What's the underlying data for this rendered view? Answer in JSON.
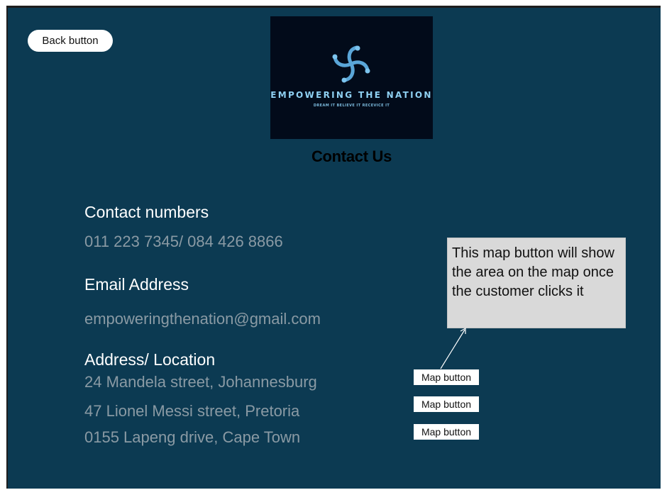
{
  "header": {
    "back_button_label": "Back button",
    "logo": {
      "title": "EMPOWERING THE NATION",
      "tagline": "DREAM IT BELIEVE IT RECEVICE IT",
      "icon": "swirl-logo-icon"
    },
    "page_title": "Contact Us"
  },
  "contact": {
    "numbers_heading": "Contact numbers",
    "numbers_value": "011 223 7345/ 084 426 8866",
    "email_heading": "Email Address",
    "email_value": "empoweringthenation@gmail.com",
    "address_heading": "Address/ Location",
    "addresses": [
      {
        "text": "24 Mandela street, Johannesburg",
        "map_button_label": "Map button"
      },
      {
        "text": "47 Lionel Messi street, Pretoria",
        "map_button_label": "Map button"
      },
      {
        "text": "0155  Lapeng drive, Cape Town",
        "map_button_label": "Map button"
      }
    ]
  },
  "annotation": {
    "text": "This map button will show the area on the map once the customer clicks it"
  },
  "colors": {
    "background": "#0c3a52",
    "logo_background": "#020b1a",
    "heading_text": "#ffffff",
    "value_text": "#8a9aa4",
    "note_background": "#d9d9d9"
  }
}
